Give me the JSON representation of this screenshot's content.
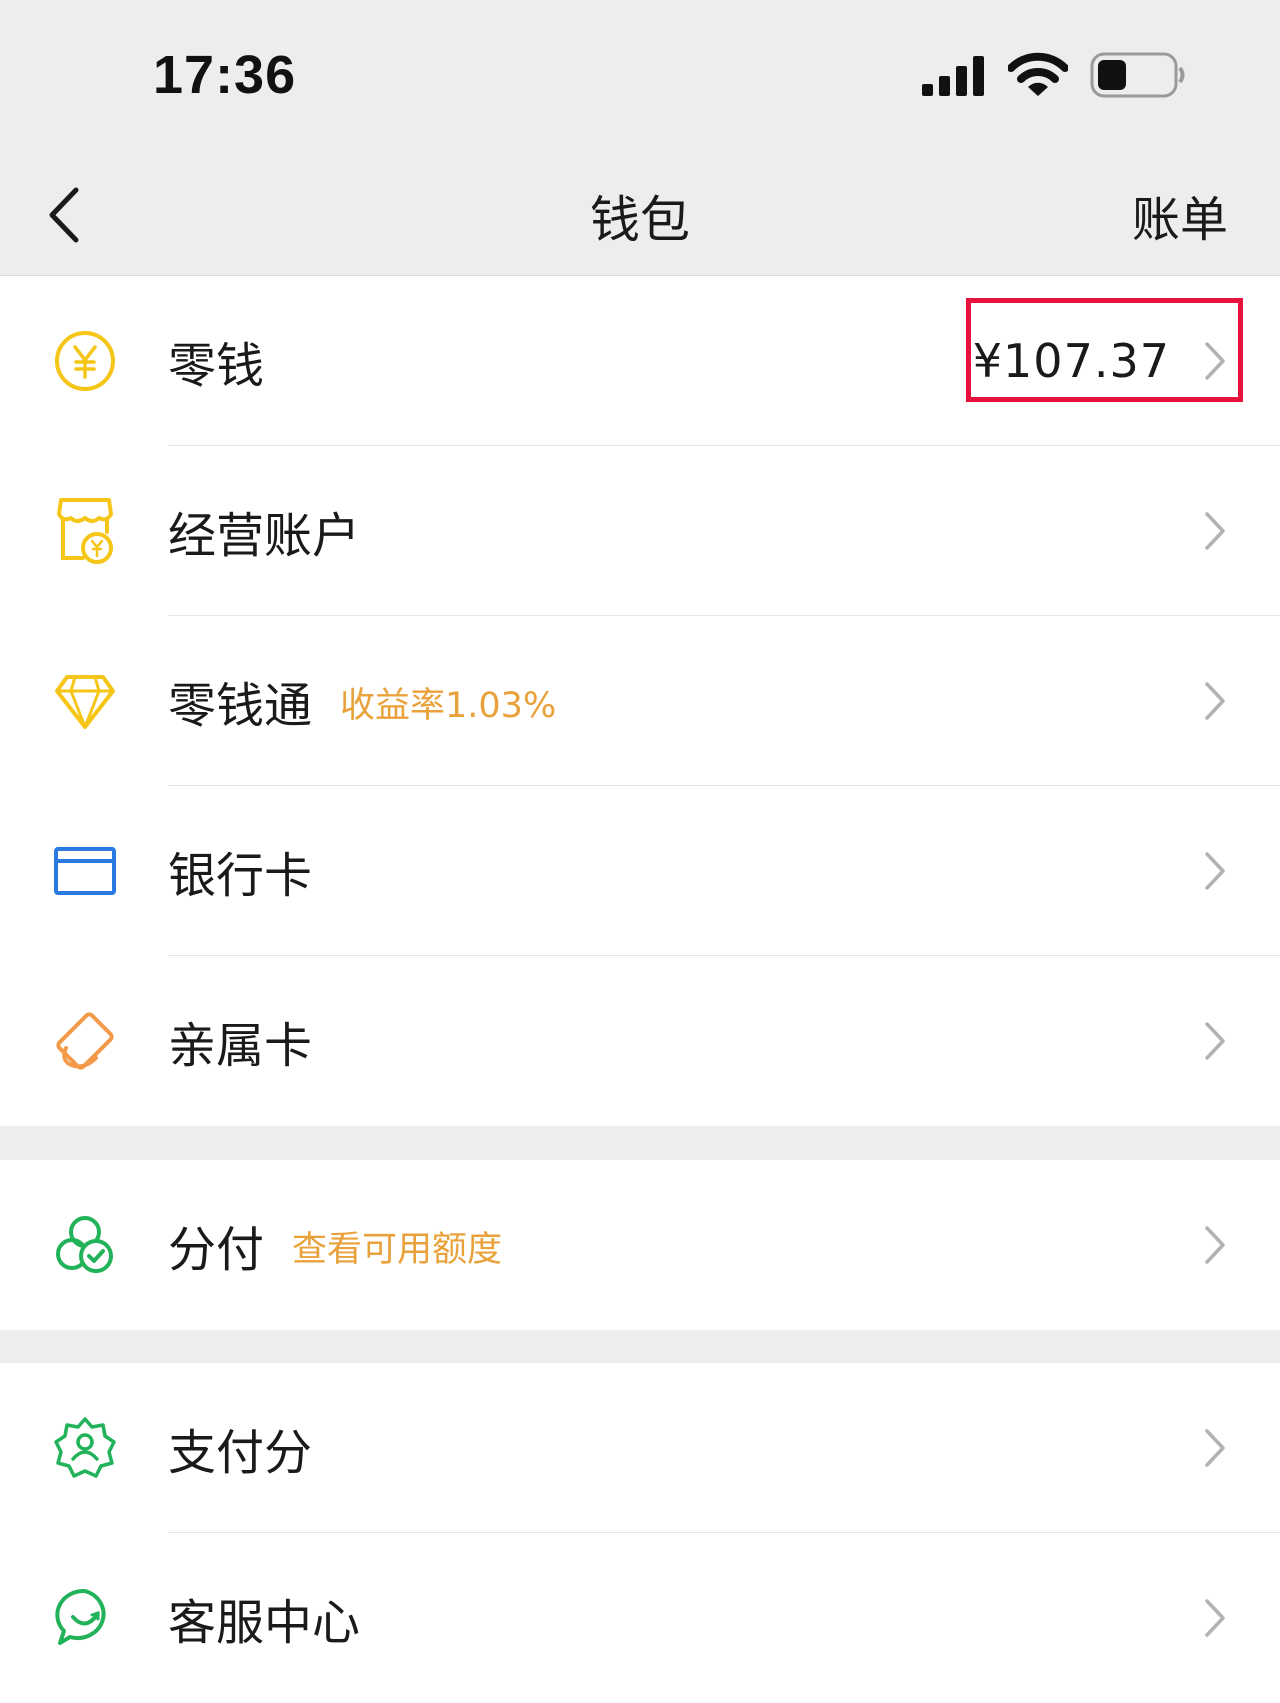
{
  "status_bar": {
    "time": "17:36",
    "icons": [
      "cellular-signal-icon",
      "wifi-icon",
      "battery-icon"
    ]
  },
  "nav": {
    "back_icon": "chevron-left-icon",
    "title": "钱包",
    "bill_label": "账单"
  },
  "groups": [
    {
      "items": [
        {
          "label": "零钱",
          "icon": "yuan-coin-icon",
          "value": "¥107.37",
          "highlighted": true
        },
        {
          "label": "经营账户",
          "icon": "store-account-icon"
        },
        {
          "label": "零钱通",
          "icon": "diamond-icon",
          "hint": "收益率1.03%"
        },
        {
          "label": "银行卡",
          "icon": "bank-card-icon"
        },
        {
          "label": "亲属卡",
          "icon": "family-card-icon"
        }
      ]
    },
    {
      "items": [
        {
          "label": "分付",
          "icon": "fenfu-icon",
          "hint": "查看可用额度"
        }
      ]
    },
    {
      "items": [
        {
          "label": "支付分",
          "icon": "pay-score-icon"
        },
        {
          "label": "客服中心",
          "icon": "customer-service-icon"
        }
      ]
    }
  ],
  "colors": {
    "background": "#ededed",
    "row_background": "#ffffff",
    "hint_orange": "#e9a23b",
    "highlight_red": "#e6123d",
    "icon_yellow": "#f5c518",
    "icon_blue": "#2a7ae2",
    "icon_orange": "#f39a4a",
    "icon_green": "#22b25a"
  }
}
